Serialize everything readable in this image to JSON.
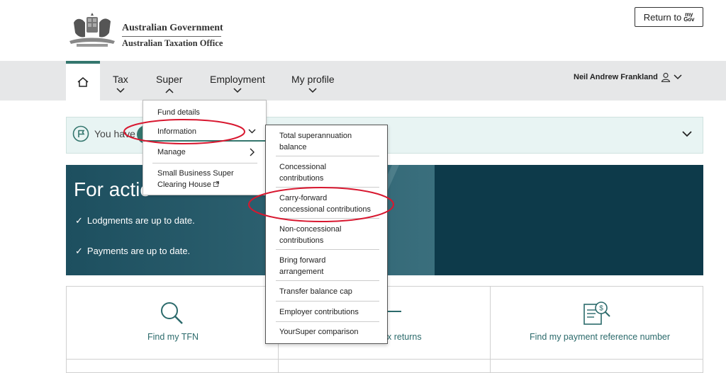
{
  "header": {
    "org_line1": "Australian Government",
    "org_line2": "Australian Taxation Office",
    "return_label": "Return to",
    "mygov_top": "my",
    "mygov_bottom": "Gov"
  },
  "nav": {
    "home_icon": "home-icon",
    "items": [
      {
        "label": "Tax"
      },
      {
        "label": "Super"
      },
      {
        "label": "Employment"
      },
      {
        "label": "My profile"
      }
    ],
    "user_name": "Neil Andrew Frankland"
  },
  "notice": {
    "text": "You have"
  },
  "action_panel": {
    "title": "For actio",
    "lines": [
      "Lodgments are up to date.",
      "Payments are up to date."
    ]
  },
  "tiles": {
    "items": [
      {
        "label": "Find my TFN",
        "icon": "search-icon"
      },
      {
        "label": "x returns",
        "icon": "minus-icon"
      },
      {
        "label": "Find my payment reference number",
        "icon": "document-search-icon"
      }
    ]
  },
  "super_menu": {
    "items": [
      {
        "label": "Fund details"
      },
      {
        "label": "Information"
      },
      {
        "label": "Manage"
      },
      {
        "label": "Small Business Super\nClearing House"
      }
    ]
  },
  "information_submenu": {
    "items": [
      {
        "label": "Total superannuation\nbalance"
      },
      {
        "label": "Concessional\ncontributions"
      },
      {
        "label": "Carry-forward\nconcessional contributions"
      },
      {
        "label": "Non-concessional\ncontributions"
      },
      {
        "label": "Bring forward\narrangement"
      },
      {
        "label": "Transfer balance cap"
      },
      {
        "label": "Employer contributions"
      },
      {
        "label": "YourSuper comparison"
      }
    ]
  },
  "colors": {
    "accent": "#34766e",
    "panel": "#0d3a4a",
    "annotation": "#d8172f"
  }
}
